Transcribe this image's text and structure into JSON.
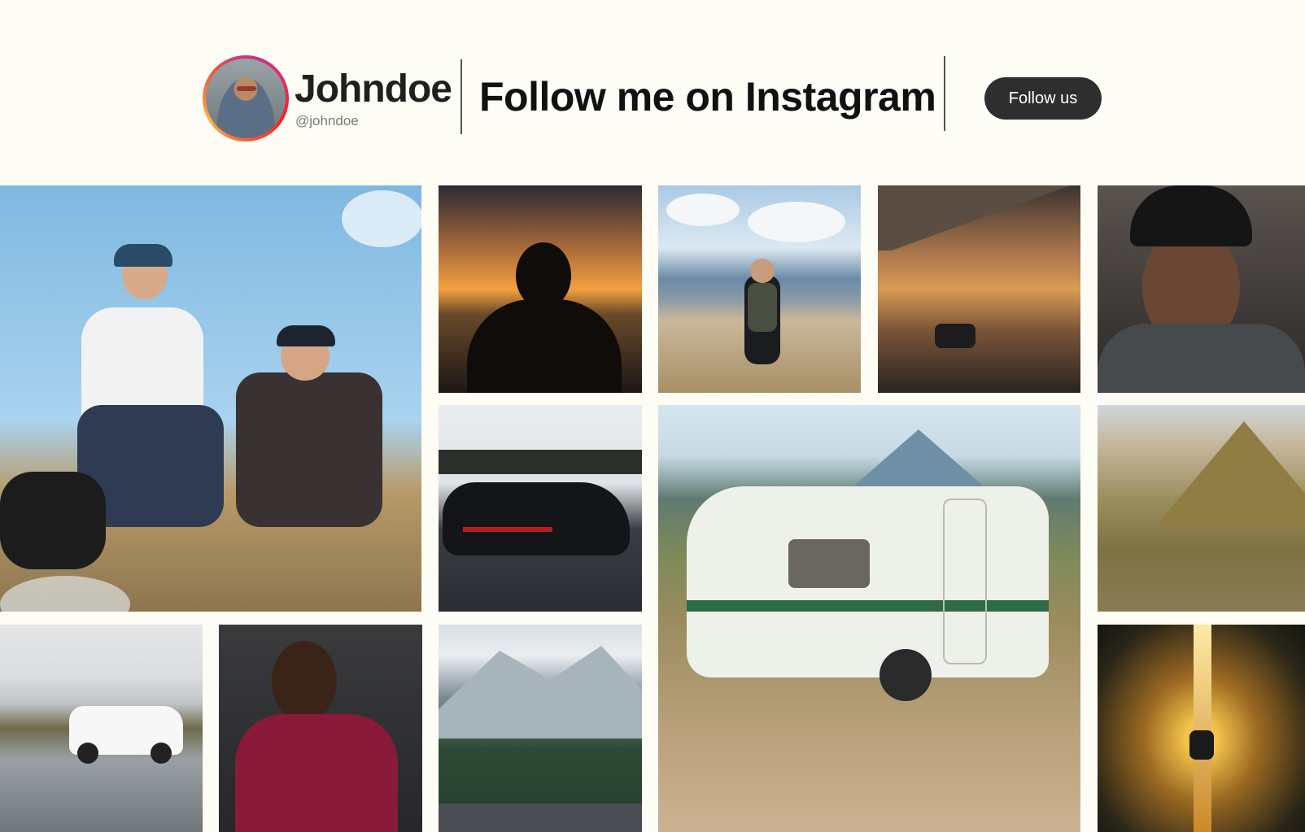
{
  "profile": {
    "name": "Johndoe",
    "handle": "@johndoe"
  },
  "headline": "Follow me on Instagram",
  "follow_button": "Follow us",
  "colors": {
    "background": "#fdfcf5",
    "button": "#2e2e2e",
    "avatar_ring": [
      "#c13584",
      "#fd1d1d",
      "#fcaf45"
    ]
  },
  "photos": [
    "two-men-sitting-on-hill",
    "silhouette-at-sunset",
    "hiker-with-sheep",
    "car-on-mountain-road-sunset",
    "man-in-beanie-portrait",
    "black-sports-car-on-road",
    "vintage-caravan-in-hills",
    "golden-hills",
    "white-suv-in-snow",
    "man-in-red-sweater",
    "mountain-road-with-pines",
    "car-headlights-forest-road"
  ]
}
